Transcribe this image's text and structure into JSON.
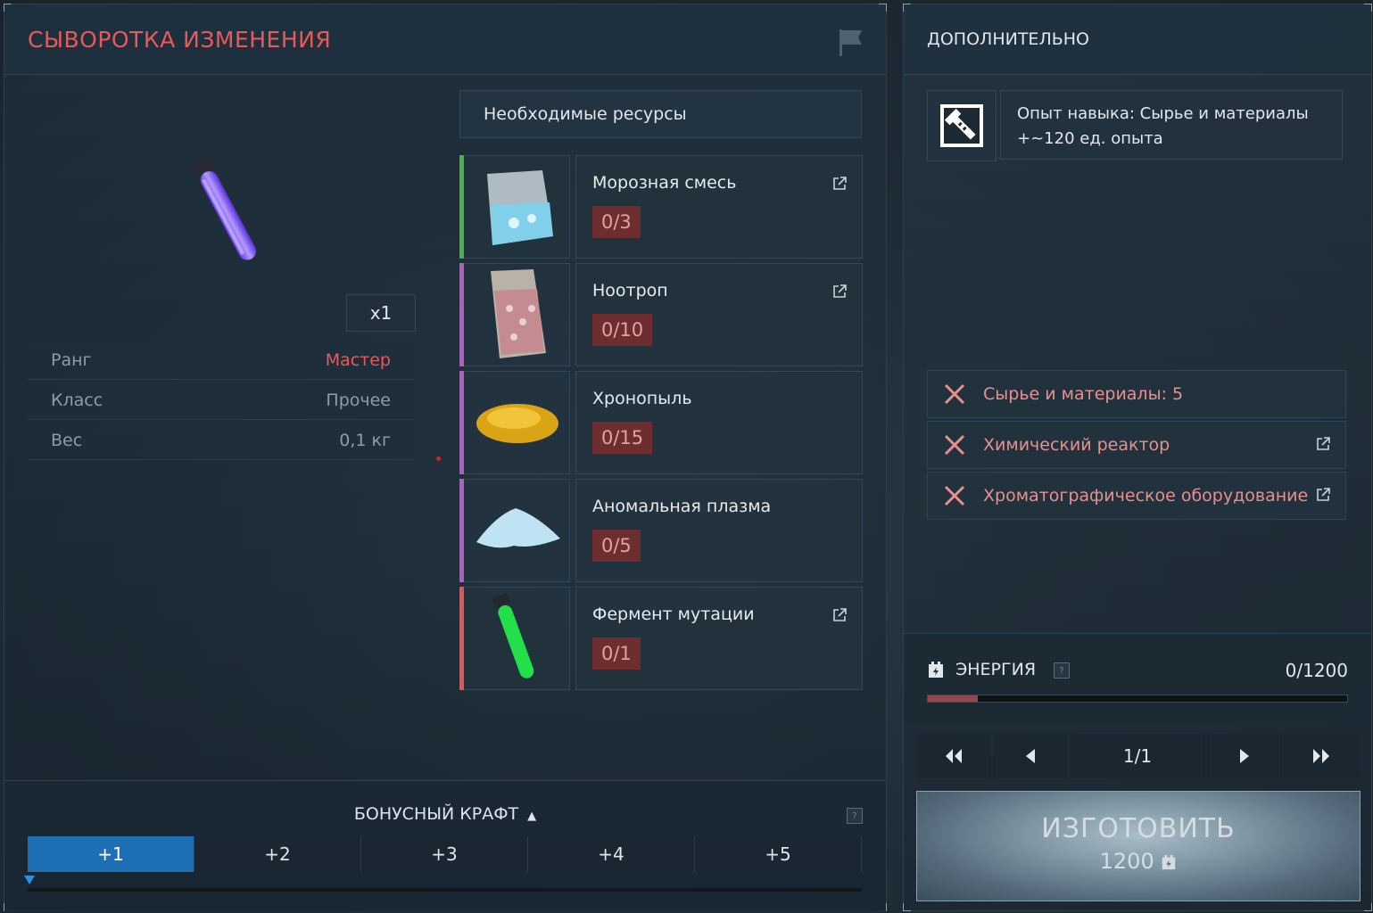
{
  "left": {
    "title": "СЫВОРОТКА ИЗМЕНЕНИЯ",
    "quantity": "x1",
    "stats": [
      {
        "label": "Ранг",
        "value": "Мастер",
        "highlight": true
      },
      {
        "label": "Класс",
        "value": "Прочее",
        "highlight": false
      },
      {
        "label": "Вес",
        "value": "0,1 кг",
        "highlight": false
      }
    ]
  },
  "resources": {
    "header": "Необходимые ресурсы",
    "items": [
      {
        "name": "Морозная смесь",
        "count": "0/3",
        "stripe_color": "#4caf50",
        "icon": "frost-mix-bag-icon"
      },
      {
        "name": "Ноотроп",
        "count": "0/10",
        "stripe_color": "#b35cc2",
        "icon": "nootrope-bag-icon"
      },
      {
        "name": "Хронопыль",
        "count": "0/15",
        "stripe_color": "#b35cc2",
        "icon": "chronodust-pile-icon"
      },
      {
        "name": "Аномальная плазма",
        "count": "0/5",
        "stripe_color": "#b35cc2",
        "icon": "anomal-plasma-pile-icon"
      },
      {
        "name": "Фермент мутации",
        "count": "0/1",
        "stripe_color": "#e05555",
        "icon": "mutation-ferment-vial-icon"
      }
    ]
  },
  "bonus": {
    "title": "БОНУСНЫЙ КРАФТ",
    "help": "?",
    "tabs": [
      "+1",
      "+2",
      "+3",
      "+4",
      "+5"
    ],
    "active_tab": 0
  },
  "extra": {
    "title": "ДОПОЛНИТЕЛЬНО",
    "xp_line1": "Опыт навыка: Сырье и материалы",
    "xp_line2": "+~120 ед. опыта",
    "requirements": [
      {
        "text": "Сырье и материалы: 5",
        "has_link": false
      },
      {
        "text": "Химический реактор",
        "has_link": true
      },
      {
        "text": "Хроматографическое оборудование",
        "has_link": true
      }
    ]
  },
  "energy": {
    "label": "ЭНЕРГИЯ",
    "help": "?",
    "value": "0/1200",
    "fill_fraction": 0.12
  },
  "pager": {
    "page": "1/1"
  },
  "craft": {
    "label": "ИЗГОТОВИТЬ",
    "cost": "1200"
  }
}
